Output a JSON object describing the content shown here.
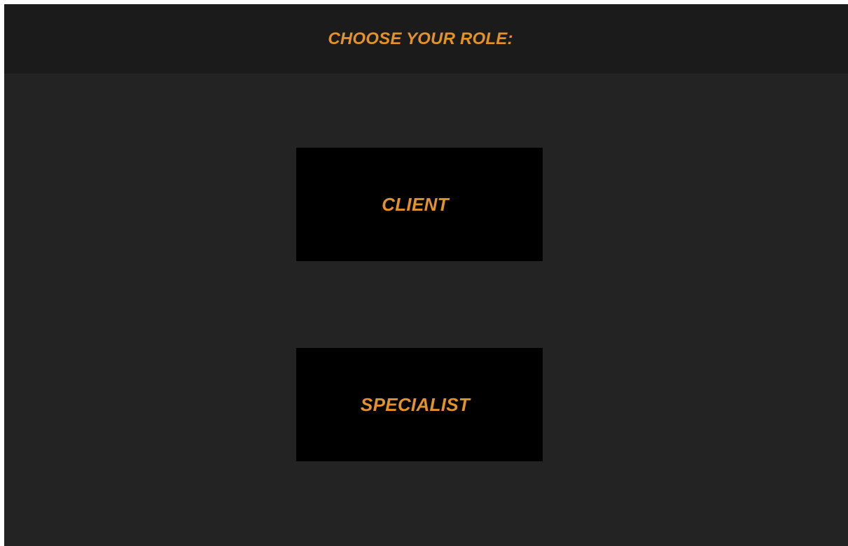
{
  "colors": {
    "accent": "#E1922A",
    "background": "#232323",
    "header_background": "#1B1B1B",
    "button_background": "#000000"
  },
  "header": {
    "title": "CHOOSE YOUR ROLE:"
  },
  "roles": [
    {
      "label": "CLIENT"
    },
    {
      "label": "SPECIALIST"
    }
  ]
}
